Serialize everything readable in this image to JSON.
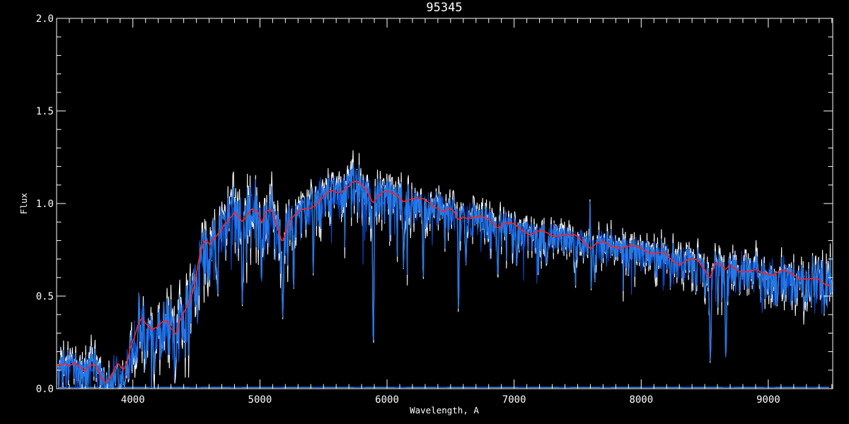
{
  "window": {
    "background": "#000000"
  },
  "chart_data": {
    "type": "line",
    "title": "95345",
    "xlabel": "Wavelength, A",
    "ylabel": "Flux",
    "xlim": [
      3400,
      9507
    ],
    "ylim": [
      0,
      2.0
    ],
    "x_major_ticks": [
      4000,
      5000,
      6000,
      7000,
      8000,
      9000
    ],
    "x_minor_step": 100,
    "y_major_ticks": [
      0.0,
      0.5,
      1.0,
      1.5,
      2.0
    ],
    "y_tick_labels": [
      "0.0",
      "0.5",
      "1.0",
      "1.5",
      "2.0"
    ],
    "y_minor_step": 0.1,
    "grid": false,
    "legend": null,
    "axis_color": "#ffffff",
    "colors": {
      "background": "#000000",
      "raw_spectrum": "#ffffff",
      "spectrum_dark": "#0b4ed6",
      "spectrum_bright": "#2579e6",
      "template_fit": "#ff2020"
    },
    "series": [
      {
        "name": "raw-spectrum-white",
        "color": "#ffffff",
        "style": "noisy line behind blue"
      },
      {
        "name": "spectrum-dark-blue",
        "color": "#0b4ed6",
        "style": "noisy line"
      },
      {
        "name": "spectrum-bright-blue",
        "color": "#2579e6",
        "style": "noisy line"
      },
      {
        "name": "template-fit-red",
        "color": "#ff2020",
        "style": "smooth line"
      }
    ],
    "zero_line_flux": 0.007,
    "continuum_points": [
      [
        3400,
        0.095
      ],
      [
        3450,
        0.12
      ],
      [
        3500,
        0.13
      ],
      [
        3540,
        0.15
      ],
      [
        3580,
        0.12
      ],
      [
        3620,
        0.09
      ],
      [
        3660,
        0.12
      ],
      [
        3700,
        0.14
      ],
      [
        3730,
        0.12
      ],
      [
        3760,
        0.07
      ],
      [
        3790,
        0.05
      ],
      [
        3820,
        0.06
      ],
      [
        3850,
        0.09
      ],
      [
        3880,
        0.12
      ],
      [
        3905,
        0.1
      ],
      [
        3930,
        0.09
      ],
      [
        3955,
        0.14
      ],
      [
        3980,
        0.22
      ],
      [
        4010,
        0.28
      ],
      [
        4040,
        0.34
      ],
      [
        4070,
        0.37
      ],
      [
        4110,
        0.33
      ],
      [
        4150,
        0.31
      ],
      [
        4190,
        0.34
      ],
      [
        4230,
        0.38
      ],
      [
        4270,
        0.39
      ],
      [
        4310,
        0.32
      ],
      [
        4340,
        0.29
      ],
      [
        4370,
        0.36
      ],
      [
        4410,
        0.42
      ],
      [
        4450,
        0.48
      ],
      [
        4490,
        0.58
      ],
      [
        4520,
        0.7
      ],
      [
        4560,
        0.78
      ],
      [
        4600,
        0.76
      ],
      [
        4640,
        0.8
      ],
      [
        4680,
        0.85
      ],
      [
        4720,
        0.9
      ],
      [
        4760,
        0.93
      ],
      [
        4800,
        0.95
      ],
      [
        4830,
        0.93
      ],
      [
        4860,
        0.9
      ],
      [
        4900,
        0.95
      ],
      [
        4940,
        0.99
      ],
      [
        4980,
        0.97
      ],
      [
        5015,
        0.89
      ],
      [
        5050,
        0.94
      ],
      [
        5090,
        0.95
      ],
      [
        5130,
        0.88
      ],
      [
        5175,
        0.79
      ],
      [
        5210,
        0.87
      ],
      [
        5250,
        0.92
      ],
      [
        5290,
        0.94
      ],
      [
        5330,
        0.96
      ],
      [
        5370,
        0.98
      ],
      [
        5410,
        1.0
      ],
      [
        5450,
        1.02
      ],
      [
        5490,
        1.04
      ],
      [
        5530,
        1.05
      ],
      [
        5570,
        1.06
      ],
      [
        5610,
        1.05
      ],
      [
        5650,
        1.07
      ],
      [
        5690,
        1.09
      ],
      [
        5730,
        1.11
      ],
      [
        5770,
        1.1
      ],
      [
        5810,
        1.08
      ],
      [
        5850,
        1.06
      ],
      [
        5890,
        1.02
      ],
      [
        5930,
        1.06
      ],
      [
        5970,
        1.07
      ],
      [
        6010,
        1.06
      ],
      [
        6050,
        1.05
      ],
      [
        6090,
        1.04
      ],
      [
        6130,
        1.02
      ],
      [
        6170,
        1.03
      ],
      [
        6210,
        1.02
      ],
      [
        6250,
        1.01
      ],
      [
        6290,
        1.0
      ],
      [
        6330,
        1.0
      ],
      [
        6370,
        0.99
      ],
      [
        6410,
        0.98
      ],
      [
        6450,
        0.96
      ],
      [
        6490,
        0.97
      ],
      [
        6530,
        0.95
      ],
      [
        6560,
        0.92
      ],
      [
        6600,
        0.95
      ],
      [
        6640,
        0.94
      ],
      [
        6680,
        0.93
      ],
      [
        6720,
        0.92
      ],
      [
        6760,
        0.91
      ],
      [
        6800,
        0.91
      ],
      [
        6840,
        0.89
      ],
      [
        6880,
        0.87
      ],
      [
        6920,
        0.89
      ],
      [
        6960,
        0.88
      ],
      [
        7000,
        0.88
      ],
      [
        7050,
        0.87
      ],
      [
        7100,
        0.86
      ],
      [
        7150,
        0.85
      ],
      [
        7200,
        0.85
      ],
      [
        7250,
        0.84
      ],
      [
        7300,
        0.83
      ],
      [
        7350,
        0.83
      ],
      [
        7400,
        0.82
      ],
      [
        7450,
        0.81
      ],
      [
        7500,
        0.81
      ],
      [
        7550,
        0.8
      ],
      [
        7600,
        0.77
      ],
      [
        7650,
        0.79
      ],
      [
        7700,
        0.79
      ],
      [
        7750,
        0.78
      ],
      [
        7800,
        0.78
      ],
      [
        7850,
        0.77
      ],
      [
        7900,
        0.76
      ],
      [
        7950,
        0.75
      ],
      [
        8000,
        0.75
      ],
      [
        8050,
        0.74
      ],
      [
        8100,
        0.73
      ],
      [
        8150,
        0.73
      ],
      [
        8200,
        0.72
      ],
      [
        8250,
        0.7
      ],
      [
        8300,
        0.69
      ],
      [
        8350,
        0.7
      ],
      [
        8400,
        0.69
      ],
      [
        8450,
        0.68
      ],
      [
        8500,
        0.64
      ],
      [
        8540,
        0.6
      ],
      [
        8580,
        0.67
      ],
      [
        8620,
        0.66
      ],
      [
        8660,
        0.62
      ],
      [
        8700,
        0.66
      ],
      [
        8750,
        0.66
      ],
      [
        8800,
        0.65
      ],
      [
        8850,
        0.64
      ],
      [
        8900,
        0.64
      ],
      [
        8950,
        0.63
      ],
      [
        9000,
        0.63
      ],
      [
        9050,
        0.62
      ],
      [
        9100,
        0.62
      ],
      [
        9150,
        0.61
      ],
      [
        9200,
        0.61
      ],
      [
        9250,
        0.6
      ],
      [
        9300,
        0.6
      ],
      [
        9350,
        0.59
      ],
      [
        9400,
        0.59
      ],
      [
        9450,
        0.58
      ],
      [
        9505,
        0.575
      ]
    ],
    "noise_envelope": [
      [
        3400,
        0.05
      ],
      [
        3600,
        0.055
      ],
      [
        3800,
        0.05
      ],
      [
        3950,
        0.06
      ],
      [
        4100,
        0.075
      ],
      [
        4250,
        0.085
      ],
      [
        4400,
        0.09
      ],
      [
        4600,
        0.085
      ],
      [
        4800,
        0.08
      ],
      [
        5000,
        0.075
      ],
      [
        5200,
        0.07
      ],
      [
        5400,
        0.065
      ],
      [
        5600,
        0.06
      ],
      [
        5800,
        0.06
      ],
      [
        6000,
        0.055
      ],
      [
        6200,
        0.055
      ],
      [
        6400,
        0.05
      ],
      [
        6600,
        0.05
      ],
      [
        6800,
        0.048
      ],
      [
        7000,
        0.045
      ],
      [
        7200,
        0.045
      ],
      [
        7400,
        0.042
      ],
      [
        7600,
        0.042
      ],
      [
        7800,
        0.04
      ],
      [
        8000,
        0.042
      ],
      [
        8200,
        0.045
      ],
      [
        8400,
        0.05
      ],
      [
        8600,
        0.052
      ],
      [
        8800,
        0.055
      ],
      [
        9000,
        0.058
      ],
      [
        9200,
        0.06
      ],
      [
        9400,
        0.065
      ],
      [
        9507,
        0.068
      ]
    ],
    "absorption_spikes": [
      [
        3782,
        0.01,
        5
      ],
      [
        3800,
        0.02,
        4
      ],
      [
        3822,
        0.0,
        4
      ],
      [
        3838,
        0.01,
        4
      ],
      [
        3862,
        0.02,
        4
      ],
      [
        3888,
        0.01,
        5
      ],
      [
        3912,
        0.03,
        4
      ],
      [
        3934,
        0.02,
        6
      ],
      [
        3966,
        0.05,
        5
      ],
      [
        4026,
        0.2,
        4
      ],
      [
        4102,
        0.15,
        5
      ],
      [
        4180,
        0.2,
        4
      ],
      [
        4227,
        0.18,
        4
      ],
      [
        4340,
        0.16,
        5
      ],
      [
        4405,
        0.26,
        4
      ],
      [
        4510,
        0.35,
        4
      ],
      [
        4668,
        0.48,
        4
      ],
      [
        4862,
        0.46,
        5
      ],
      [
        5012,
        0.55,
        4
      ],
      [
        5180,
        0.39,
        5
      ],
      [
        5265,
        0.52,
        4
      ],
      [
        5420,
        0.62,
        4
      ],
      [
        5892,
        0.21,
        5
      ],
      [
        6130,
        0.65,
        4
      ],
      [
        6285,
        0.6,
        4
      ],
      [
        6562,
        0.4,
        4
      ],
      [
        6620,
        0.66,
        4
      ],
      [
        6872,
        0.6,
        5
      ],
      [
        7020,
        0.65,
        4
      ],
      [
        7190,
        0.6,
        4
      ],
      [
        7255,
        0.66,
        4
      ],
      [
        7606,
        0.53,
        5
      ],
      [
        7635,
        0.58,
        4
      ],
      [
        7900,
        0.6,
        4
      ],
      [
        8230,
        0.54,
        4
      ],
      [
        8430,
        0.52,
        4
      ],
      [
        8544,
        0.13,
        5
      ],
      [
        8666,
        0.15,
        5
      ],
      [
        8775,
        0.5,
        4
      ],
      [
        8940,
        0.47,
        4
      ],
      [
        9070,
        0.46,
        4
      ],
      [
        9215,
        0.47,
        4
      ],
      [
        9340,
        0.44,
        5
      ],
      [
        9440,
        0.43,
        4
      ]
    ],
    "emission_spikes": [
      [
        4048,
        0.52,
        3
      ],
      [
        7598,
        1.02,
        3
      ],
      [
        9347,
        0.73,
        3
      ],
      [
        9395,
        0.7,
        3
      ]
    ]
  }
}
